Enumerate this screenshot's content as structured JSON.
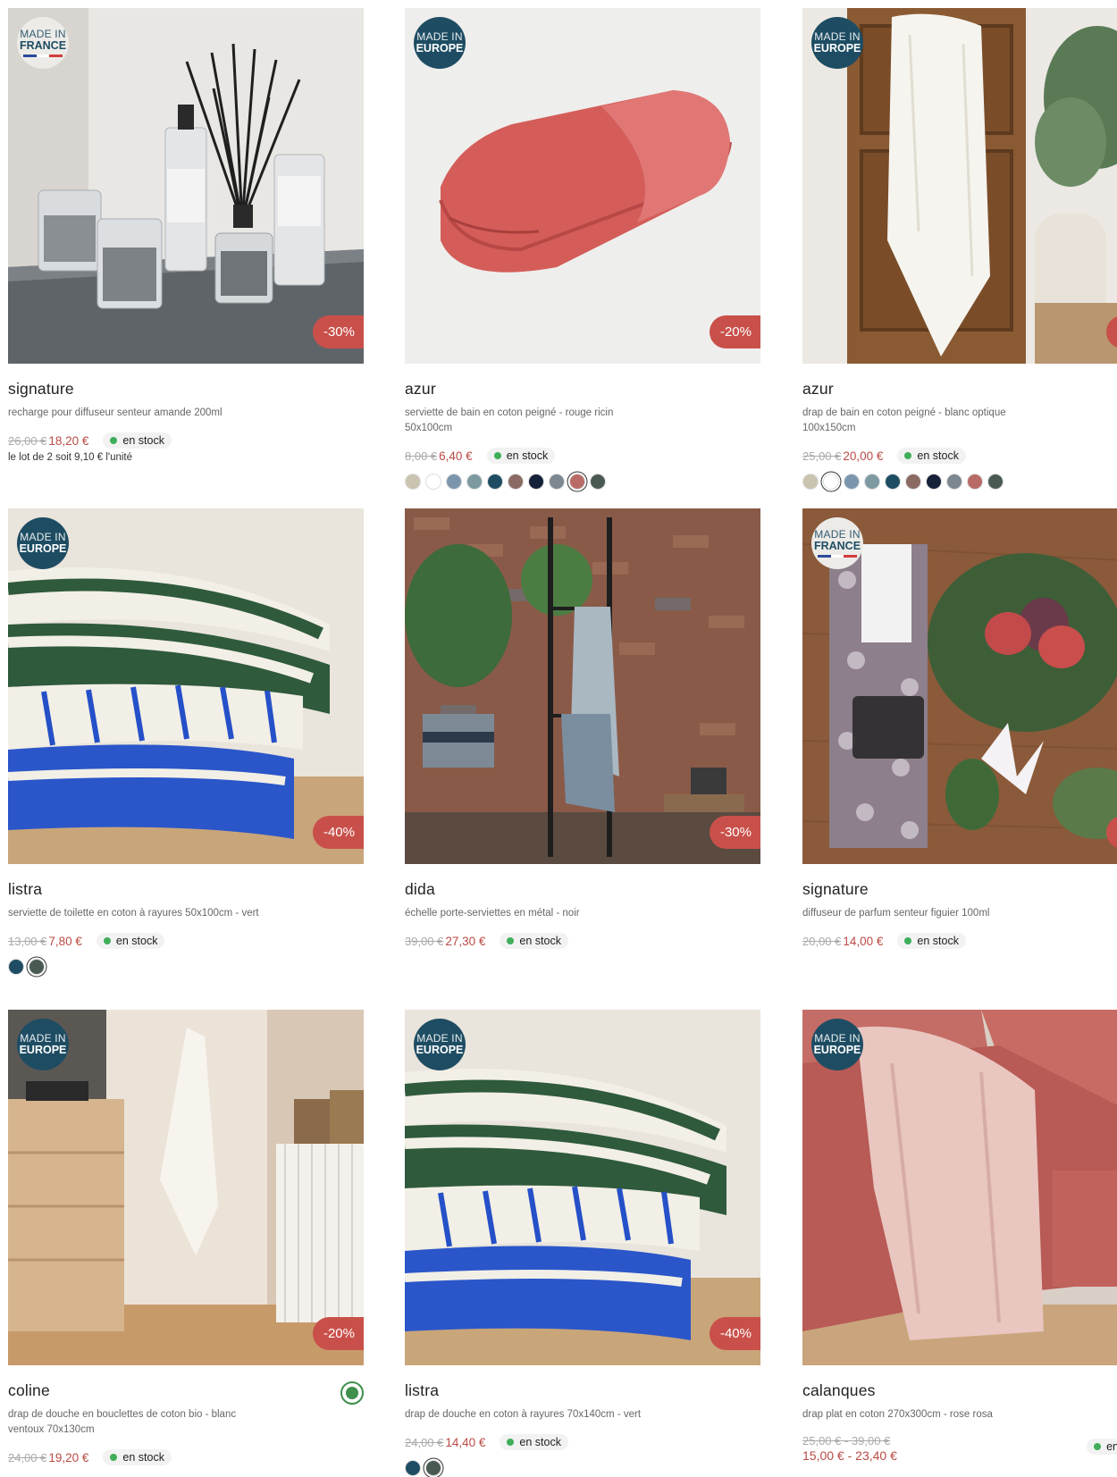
{
  "products": [
    {
      "id": "p1",
      "name": "signature",
      "desc": "recharge pour diffuseur senteur amande 200ml",
      "old_price": "26,00 €",
      "price": "18,20 €",
      "stock": "en stock",
      "note": "le lot de 2 soit 9,10 € l'unité",
      "discount": "-30%",
      "badge_l1": "MADE IN",
      "badge_l2": "FRANCE",
      "swatches": []
    },
    {
      "id": "p2",
      "name": "azur",
      "desc": "serviette de bain en coton peigné - rouge ricin 50x100cm",
      "old_price": "8,00 €",
      "price": "6,40 €",
      "stock": "en stock",
      "discount": "-20%",
      "badge_l1": "MADE IN",
      "badge_l2": "EUROPE",
      "swatches": [
        "#c9c3b0",
        "#ffffff",
        "#7b95ad",
        "#7d9aa1",
        "#1e4d63",
        "#8a6a63",
        "#16213a",
        "#7c8790",
        "#b86a66",
        "#4a5a52"
      ]
    },
    {
      "id": "p3",
      "name": "azur",
      "desc": "drap de bain en coton peigné - blanc optique 100x150cm",
      "old_price": "25,00 €",
      "price": "20,00 €",
      "stock": "en stock",
      "badge_l1": "MADE IN",
      "badge_l2": "EUROPE",
      "swatches": [
        "#c9c3b0",
        "#ffffff",
        "#7b95ad",
        "#7d9aa1",
        "#1e4d63",
        "#8a6a63",
        "#16213a",
        "#7c8790",
        "#b86a66",
        "#4a5a52"
      ]
    },
    {
      "id": "p4",
      "name": "listra",
      "desc": "serviette de toilette en coton à rayures 50x100cm - vert",
      "old_price": "13,00 €",
      "price": "7,80 €",
      "stock": "en stock",
      "discount": "-40%",
      "badge_l1": "MADE IN",
      "badge_l2": "EUROPE",
      "swatches": [
        "#1e4d63",
        "#4a5a52"
      ]
    },
    {
      "id": "p5",
      "name": "dida",
      "desc": "échelle porte-serviettes en métal - noir",
      "old_price": "39,00 €",
      "price": "27,30 €",
      "stock": "en stock",
      "discount": "-30%",
      "swatches": []
    },
    {
      "id": "p6",
      "name": "signature",
      "desc": "diffuseur de parfum senteur figuier 100ml",
      "old_price": "20,00 €",
      "price": "14,00 €",
      "stock": "en stock",
      "badge_l1": "MADE IN",
      "badge_l2": "FRANCE",
      "swatches": []
    },
    {
      "id": "p7",
      "name": "coline",
      "desc": "drap de douche en bouclettes de coton bio - blanc ventoux 70x130cm",
      "old_price": "24,00 €",
      "price": "19,20 €",
      "stock": "en stock",
      "discount": "-20%",
      "badge_l1": "MADE IN",
      "badge_l2": "EUROPE",
      "swatches": []
    },
    {
      "id": "p8",
      "name": "listra",
      "desc": "drap de douche en coton à rayures 70x140cm - vert",
      "old_price": "24,00 €",
      "price": "14,40 €",
      "stock": "en stock",
      "discount": "-40%",
      "badge_l1": "MADE IN",
      "badge_l2": "EUROPE",
      "swatches": [
        "#1e4d63",
        "#4a5a52"
      ]
    },
    {
      "id": "p9",
      "name": "calanques",
      "desc": "drap plat en coton 270x300cm - rose rosa",
      "old_price": "25,00 € - 39,00 €",
      "price": "15,00 € - 23,40 €",
      "stock": "en",
      "badge_l1": "MADE IN",
      "badge_l2": "EUROPE",
      "swatches": []
    }
  ],
  "icons": {
    "eco": "organic-cotton-icon",
    "stock": "stock-dot-icon"
  },
  "colors": {
    "accent_price": "#b94a44",
    "discount_bg": "#c9504a",
    "badge_europe": "#1e4d63",
    "stock_dot": "#3fae5a"
  }
}
